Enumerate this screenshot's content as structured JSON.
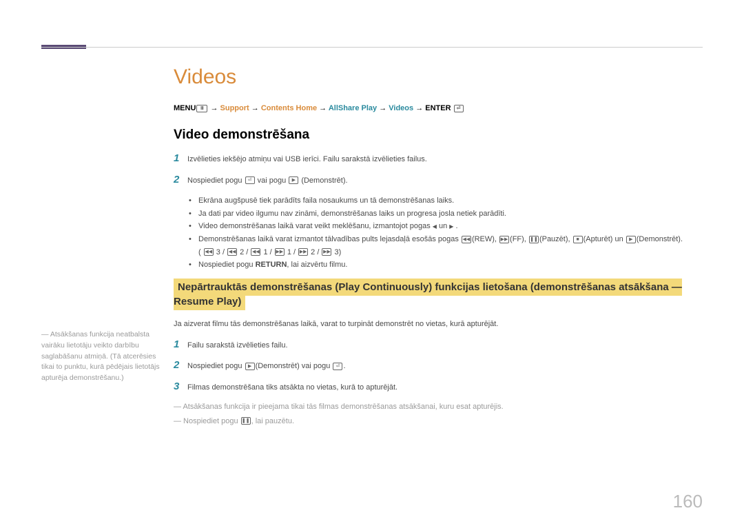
{
  "page_number": "160",
  "title": "Videos",
  "nav": {
    "menu": "MENU",
    "support": "Support",
    "contents_home": "Contents Home",
    "allshare": "AllShare Play",
    "videos": "Videos",
    "enter": "ENTER"
  },
  "h2": "Video demonstrēšana",
  "step1": "Izvēlieties iekšējo atmiņu vai USB ierīci. Failu sarakstā izvēlieties failus.",
  "step2_a": "Nospiediet pogu ",
  "step2_b": " vai pogu ",
  "step2_c": " (Demonstrēt).",
  "bul1": "Ekrāna augšpusē tiek parādīts faila nosaukums un tā demonstrēšanas laiks.",
  "bul2": "Ja dati par video ilgumu nav zināmi, demonstrēšanas laiks un progresa josla netiek parādīti.",
  "bul3_a": "Video demonstrēšanas laikā varat veikt meklēšanu, izmantojot pogas ",
  "bul3_b": " un ",
  "bul3_c": " .",
  "bul4_a": "Demonstrēšanas laikā varat izmantot tālvadības pults lejasdaļā esošās pogas ",
  "bul4_rew": "(REW), ",
  "bul4_ff": "(FF), ",
  "bul4_pause": "(Pauzēt), ",
  "bul4_stop": "(Apturēt) un ",
  "bul4_play": "(Demonstrēt).",
  "bul4_line2_a": "( ",
  "bul4_line2_b": " 3 / ",
  "bul4_line2_c": " 2 / ",
  "bul4_line2_d": " 1 / ",
  "bul4_line2_e": " 1 / ",
  "bul4_line2_f": " 2 / ",
  "bul4_line2_g": " 3)",
  "bul5_a": "Nospiediet pogu ",
  "bul5_b": "RETURN",
  "bul5_c": ", lai aizvērtu filmu.",
  "hl": "Nepārtrauktās demonstrēšanas (Play Continuously) funkcijas lietošana (demonstrēšanas atsākšana — Resume Play)",
  "resume_intro": "Ja aizverat filmu tās demonstrēšanas laikā, varat to turpināt demonstrēt no vietas, kurā apturējāt.",
  "sidebar": "― Atsākšanas funkcija neatbalsta vairāku lietotāju veikto darbību saglabāšanu atmiņā. (Tā atcerēsies tikai to punktu, kurā pēdējais lietotājs apturēja demonstrēšanu.)",
  "r_step1": "Failu sarakstā izvēlieties failu.",
  "r_step2_a": "Nospiediet pogu ",
  "r_step2_b": "(Demonstrēt) vai pogu ",
  "r_step2_c": ".",
  "r_step3": "Filmas demonstrēšana tiks atsākta no vietas, kurā to apturējāt.",
  "note1": "― Atsākšanas funkcija ir pieejama tikai tās filmas demonstrēšanas atsākšanai, kuru esat apturējis.",
  "note2_a": "― Nospiediet pogu ",
  "note2_b": ", lai pauzētu."
}
